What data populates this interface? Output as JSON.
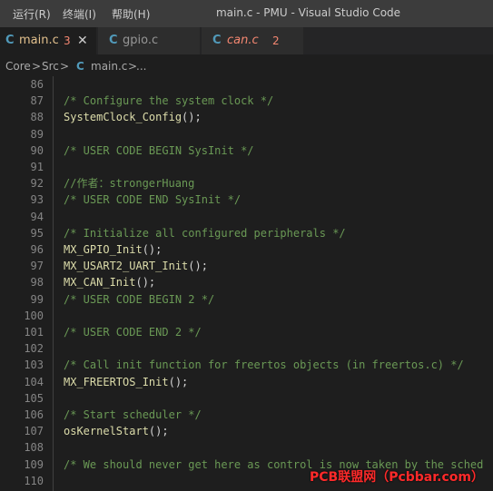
{
  "titlebar": {
    "menu": [
      "运行(R)",
      "终端(I)",
      "帮助(H)"
    ],
    "title": "main.c - PMU - Visual Studio Code"
  },
  "tabs": [
    {
      "name": "main.c",
      "problems": "3",
      "close_icon": "close-icon",
      "active": true
    },
    {
      "name": "gpio.c",
      "active": false
    },
    {
      "name": "can.c",
      "problems": "2",
      "active": false
    }
  ],
  "breadcrumb": {
    "parts": [
      "Core",
      "Src",
      "main.c",
      "..."
    ],
    "separator": ">",
    "file_icon": "C"
  },
  "editor": {
    "lines": [
      {
        "n": "86",
        "t": ""
      },
      {
        "n": "87",
        "t": "/* Configure the system clock */",
        "k": "comment"
      },
      {
        "n": "88",
        "fn": "SystemClock_Config",
        "rest": "();",
        "k": "call"
      },
      {
        "n": "89",
        "t": ""
      },
      {
        "n": "90",
        "t": "/* USER CODE BEGIN SysInit */",
        "k": "comment"
      },
      {
        "n": "91",
        "t": ""
      },
      {
        "n": "92",
        "t": "//作者：strongerHuang",
        "k": "comment"
      },
      {
        "n": "93",
        "t": "/* USER CODE END SysInit */",
        "k": "comment"
      },
      {
        "n": "94",
        "t": ""
      },
      {
        "n": "95",
        "t": "/* Initialize all configured peripherals */",
        "k": "comment"
      },
      {
        "n": "96",
        "fn": "MX_GPIO_Init",
        "rest": "();",
        "k": "call"
      },
      {
        "n": "97",
        "fn": "MX_USART2_UART_Init",
        "rest": "();",
        "k": "call"
      },
      {
        "n": "98",
        "fn": "MX_CAN_Init",
        "rest": "();",
        "k": "call"
      },
      {
        "n": "99",
        "t": "/* USER CODE BEGIN 2 */",
        "k": "comment"
      },
      {
        "n": "100",
        "t": ""
      },
      {
        "n": "101",
        "t": "/* USER CODE END 2 */",
        "k": "comment"
      },
      {
        "n": "102",
        "t": ""
      },
      {
        "n": "103",
        "t": "/* Call init function for freertos objects (in freertos.c) */",
        "k": "comment"
      },
      {
        "n": "104",
        "fn": "MX_FREERTOS_Init",
        "rest": "();",
        "k": "call"
      },
      {
        "n": "105",
        "t": ""
      },
      {
        "n": "106",
        "t": "/* Start scheduler */",
        "k": "comment"
      },
      {
        "n": "107",
        "fn": "osKernelStart",
        "rest": "();",
        "k": "call"
      },
      {
        "n": "108",
        "t": ""
      },
      {
        "n": "109",
        "t": "/* We should never get here as control is now taken by the sched",
        "k": "comment"
      },
      {
        "n": "110",
        "t": ""
      }
    ]
  },
  "watermark": "PCB联盟网（Pcbbar.com）",
  "colors": {
    "background": "#1e1e1e",
    "titlebar": "#3c3c3c",
    "comment": "#6a9955",
    "function": "#dcdcaa",
    "c_icon": "#519aba",
    "error_count": "#f48771",
    "watermark": "#ff2a2a"
  }
}
